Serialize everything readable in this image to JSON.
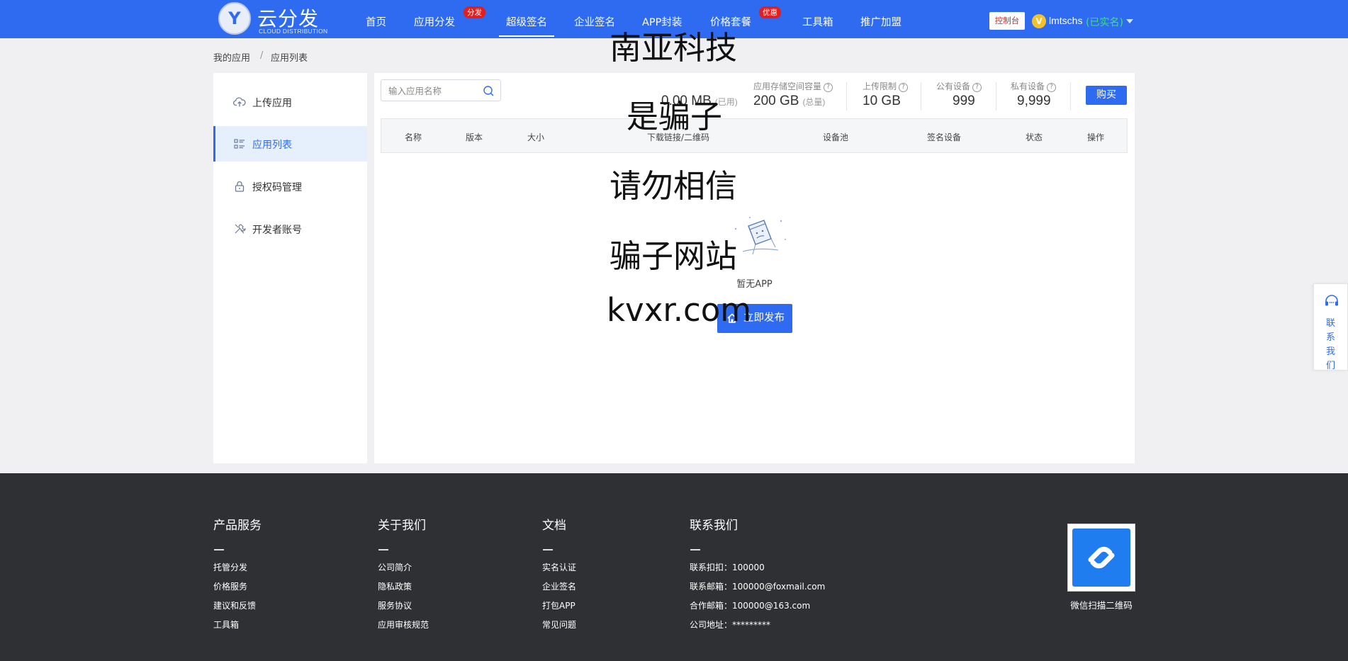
{
  "header": {
    "logo_letter": "Y",
    "logo_cn": "云分发",
    "logo_en": "CLOUD DISTRIBUTION",
    "nav": [
      {
        "label": "首页"
      },
      {
        "label": "应用分发",
        "badge": "分发"
      },
      {
        "label": "超级签名",
        "active": true
      },
      {
        "label": "企业签名"
      },
      {
        "label": "APP封装"
      },
      {
        "label": "价格套餐",
        "badge": "优惠"
      },
      {
        "label": "工具箱"
      },
      {
        "label": "推广加盟"
      }
    ],
    "console_label": "控制台",
    "user_avatar": "V",
    "user_name": "lmtschs",
    "user_verified": "(已实名)"
  },
  "breadcrumb": {
    "home": "我的应用",
    "separator": "/",
    "current": "应用列表"
  },
  "sidebar": {
    "items": [
      {
        "label": "上传应用",
        "icon": "upload-cloud-icon"
      },
      {
        "label": "应用列表",
        "icon": "list-icon",
        "active": true
      },
      {
        "label": "授权码管理",
        "icon": "lock-icon"
      },
      {
        "label": "开发者账号",
        "icon": "tools-icon"
      }
    ]
  },
  "main": {
    "search_placeholder": "输入应用名称",
    "used": {
      "value": "0.00 MB",
      "note": "(已用)"
    },
    "storage": {
      "label": "应用存储空间容量",
      "value": "200 GB",
      "note": "(总量)"
    },
    "upload_limit": {
      "label": "上传限制",
      "value": "10 GB"
    },
    "public_devices": {
      "label": "公有设备",
      "value": "999"
    },
    "private_devices": {
      "label": "私有设备",
      "value": "9,999"
    },
    "help_mark": "?",
    "buy_label": "购买",
    "columns": [
      "名称",
      "版本",
      "大小",
      "下载链接/二维码",
      "设备池",
      "签名设备",
      "状态",
      "操作"
    ],
    "empty_text": "暂无APP",
    "publish_label": "立即发布"
  },
  "overlay": {
    "lines": [
      "南亚科技",
      "是骗子",
      "请勿相信",
      "骗子网站",
      "kvxr.com"
    ]
  },
  "contact_float": {
    "chars": [
      "联",
      "系",
      "我",
      "们"
    ]
  },
  "footer": {
    "columns": [
      {
        "heading": "产品服务",
        "links": [
          "托管分发",
          "价格服务",
          "建议和反馈",
          "工具箱"
        ]
      },
      {
        "heading": "关于我们",
        "links": [
          "公司简介",
          "隐私政策",
          "服务协议",
          "应用审核规范"
        ]
      },
      {
        "heading": "文档",
        "links": [
          "实名认证",
          "企业签名",
          "打包APP",
          "常见问题"
        ]
      },
      {
        "heading": "联系我们",
        "links": [
          "联系扣扣：100000",
          "联系邮箱：100000@foxmail.com",
          "合作邮箱：100000@163.com",
          "公司地址：*********"
        ]
      }
    ],
    "qr_caption": "微信扫描二维码"
  },
  "colors": {
    "brand": "#2f6bf1",
    "badge": "#e21e1e",
    "footer_bg": "#2f3033",
    "verified": "#3fe07a"
  }
}
